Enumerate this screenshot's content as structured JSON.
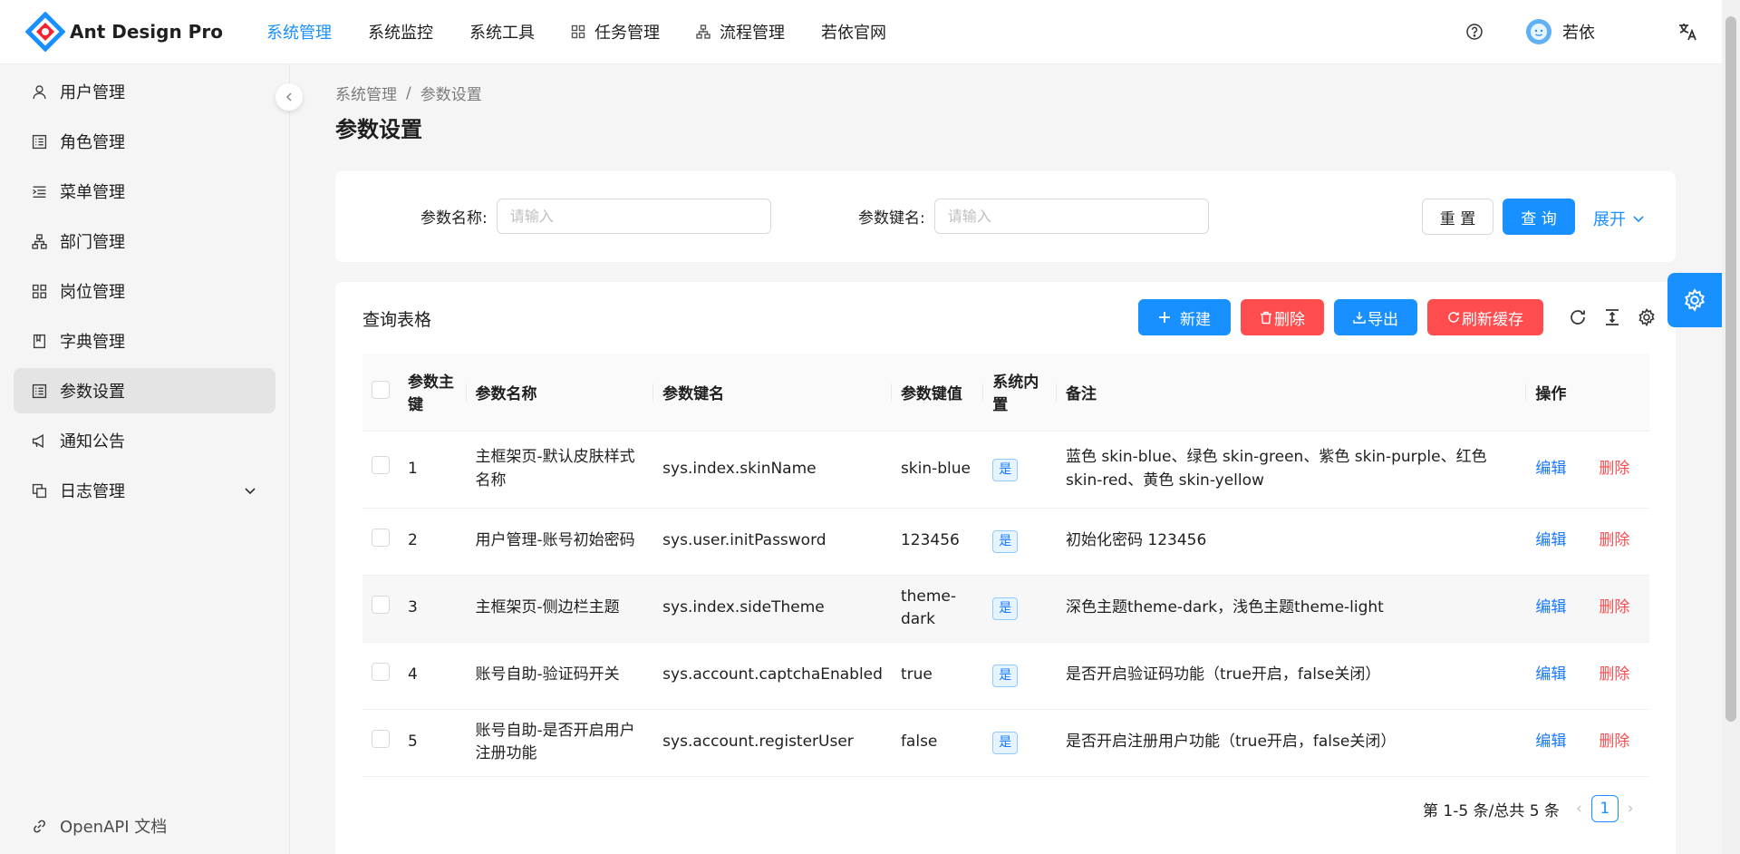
{
  "app": {
    "title": "Ant Design Pro"
  },
  "topnav": [
    {
      "label": "系统管理",
      "active": true,
      "icon": ""
    },
    {
      "label": "系统监控",
      "active": false,
      "icon": ""
    },
    {
      "label": "系统工具",
      "active": false,
      "icon": ""
    },
    {
      "label": "任务管理",
      "active": false,
      "icon": "appstore-icon"
    },
    {
      "label": "流程管理",
      "active": false,
      "icon": "cluster-icon"
    },
    {
      "label": "若依官网",
      "active": false,
      "icon": ""
    }
  ],
  "header": {
    "username": "若依"
  },
  "sidebar": {
    "items": [
      {
        "label": "用户管理",
        "icon": "user-icon"
      },
      {
        "label": "角色管理",
        "icon": "profile-icon"
      },
      {
        "label": "菜单管理",
        "icon": "menu-icon"
      },
      {
        "label": "部门管理",
        "icon": "cluster-icon"
      },
      {
        "label": "岗位管理",
        "icon": "appstore-icon"
      },
      {
        "label": "字典管理",
        "icon": "book-icon"
      },
      {
        "label": "参数设置",
        "icon": "profile-icon",
        "active": true
      },
      {
        "label": "通知公告",
        "icon": "notification-icon"
      },
      {
        "label": "日志管理",
        "icon": "copy-icon"
      }
    ],
    "footer": "OpenAPI 文档"
  },
  "breadcrumb": [
    "系统管理",
    "参数设置"
  ],
  "page_title": "参数设置",
  "search": {
    "name_label": "参数名称:",
    "name_placeholder": "请输入",
    "key_label": "参数键名:",
    "key_placeholder": "请输入",
    "reset_label": "重 置",
    "query_label": "查 询",
    "expand_label": "展开"
  },
  "table": {
    "title": "查询表格",
    "toolbar": {
      "new_label": "新建",
      "delete_label": "删除",
      "export_label": "导出",
      "refresh_cache_label": "刷新缓存"
    },
    "columns": [
      "参数主键",
      "参数名称",
      "参数键名",
      "参数键值",
      "系统内置",
      "备注",
      "操作"
    ],
    "rows": [
      {
        "id": "1",
        "name": "主框架页-默认皮肤样式名称",
        "key": "sys.index.skinName",
        "value": "skin-blue",
        "builtin": "是",
        "remark": "蓝色 skin-blue、绿色 skin-green、紫色 skin-purple、红色 skin-red、黄色 skin-yellow"
      },
      {
        "id": "2",
        "name": "用户管理-账号初始密码",
        "key": "sys.user.initPassword",
        "value": "123456",
        "builtin": "是",
        "remark": "初始化密码 123456"
      },
      {
        "id": "3",
        "name": "主框架页-侧边栏主题",
        "key": "sys.index.sideTheme",
        "value": "theme-dark",
        "builtin": "是",
        "remark": "深色主题theme-dark，浅色主题theme-light"
      },
      {
        "id": "4",
        "name": "账号自助-验证码开关",
        "key": "sys.account.captchaEnabled",
        "value": "true",
        "builtin": "是",
        "remark": "是否开启验证码功能（true开启，false关闭）"
      },
      {
        "id": "5",
        "name": "账号自助-是否开启用户注册功能",
        "key": "sys.account.registerUser",
        "value": "false",
        "builtin": "是",
        "remark": "是否开启注册用户功能（true开启，false关闭）"
      }
    ],
    "edit_label": "编辑",
    "delete_label": "删除"
  },
  "pagination": {
    "summary": "第 1-5 条/总共 5 条",
    "current": "1"
  },
  "colors": {
    "primary": "#1890ff",
    "danger": "#ff4d4f"
  }
}
